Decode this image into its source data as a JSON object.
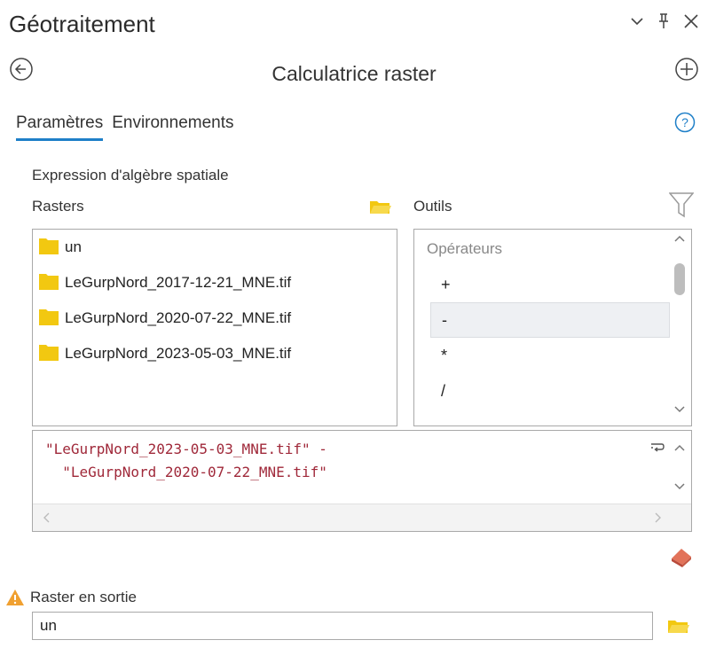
{
  "panel": {
    "title": "Géotraitement"
  },
  "tool": {
    "name": "Calculatrice raster"
  },
  "tabs": [
    {
      "label": "Paramètres",
      "active": true
    },
    {
      "label": "Environnements",
      "active": false
    }
  ],
  "section": {
    "expression_label": "Expression d'algèbre spatiale",
    "rasters_label": "Rasters",
    "tools_label": "Outils"
  },
  "rasters": [
    {
      "label": "un"
    },
    {
      "label": "LeGurpNord_2017-12-21_MNE.tif"
    },
    {
      "label": "LeGurpNord_2020-07-22_MNE.tif"
    },
    {
      "label": "LeGurpNord_2023-05-03_MNE.tif"
    }
  ],
  "operators": {
    "header": "Opérateurs",
    "items": [
      {
        "label": "+",
        "selected": false
      },
      {
        "label": "-",
        "selected": true
      },
      {
        "label": "*",
        "selected": false
      },
      {
        "label": "/",
        "selected": false
      }
    ]
  },
  "expression": {
    "line1": "\"LeGurpNord_2023-05-03_MNE.tif\" -",
    "line2": "  \"LeGurpNord_2020-07-22_MNE.tif\""
  },
  "output": {
    "label": "Raster en sortie",
    "value": "un"
  },
  "colors": {
    "accent": "#1e7fc8",
    "folder": "#f2c811",
    "expr_text": "#a0293a",
    "warning": "#f0a030"
  }
}
